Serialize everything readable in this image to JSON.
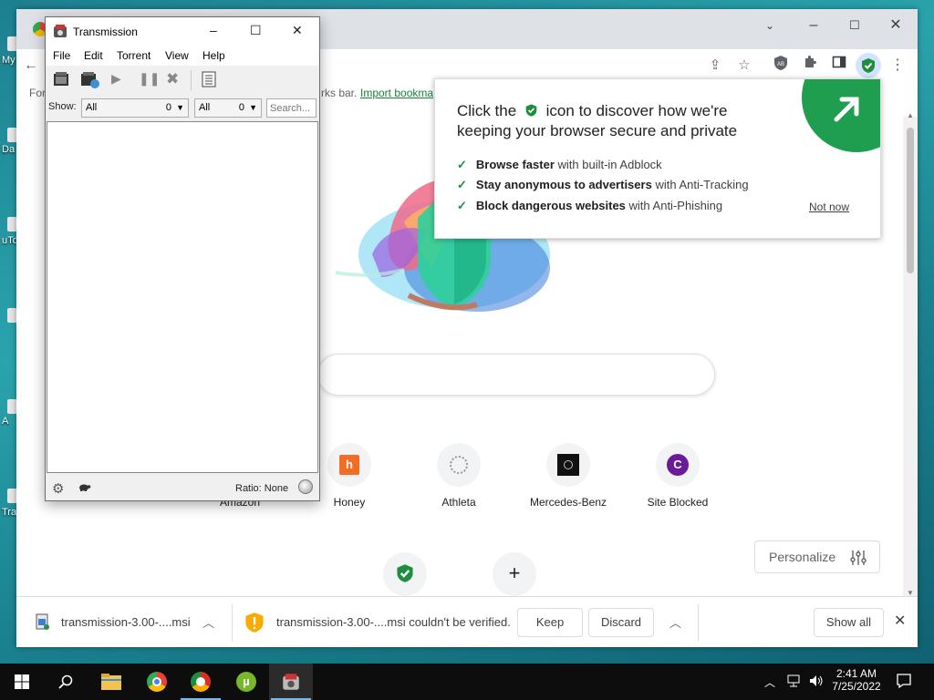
{
  "desktop": {
    "labels": [
      "My",
      "Da",
      "uTo",
      "A",
      "Tra"
    ]
  },
  "transmission": {
    "title": "Transmission",
    "menu": [
      "File",
      "Edit",
      "Torrent",
      "View",
      "Help"
    ],
    "filter": {
      "show_label": "Show:",
      "status_value": "All",
      "status_count": "0",
      "tracker_value": "All",
      "tracker_count": "0",
      "search_placeholder": "Search..."
    },
    "status": {
      "ratio": "Ratio: None"
    }
  },
  "browser": {
    "bookmarks": {
      "prefix": "For",
      "mid": "rks bar.",
      "import_link": "Import bookma"
    },
    "popup": {
      "heading_pre": "Click the",
      "heading_post": "icon to discover how we're keeping your browser secure and private",
      "items": [
        {
          "bold": "Browse faster",
          "rest": "with built-in Adblock"
        },
        {
          "bold": "Stay anonymous to advertisers",
          "rest": "with Anti-Tracking"
        },
        {
          "bold": "Block dangerous websites",
          "rest": "with Anti-Phishing"
        }
      ],
      "not_now": "Not now"
    },
    "shortcuts": [
      {
        "label": "Amazon"
      },
      {
        "label": "Honey"
      },
      {
        "label": "Athleta"
      },
      {
        "label": "Mercedes-Benz"
      },
      {
        "label": "Site Blocked",
        "letter": "C"
      }
    ],
    "personalize": "Personalize",
    "downloads": {
      "item1": "transmission-3.00-....msi",
      "item2": "transmission-3.00-....msi couldn't be verified.",
      "keep": "Keep",
      "discard": "Discard",
      "show_all": "Show all"
    }
  },
  "taskbar": {
    "time": "2:41 AM",
    "date": "7/25/2022"
  },
  "colors": {
    "accent_green": "#1e8e3e",
    "shield_green": "#1e9e4e",
    "link_green": "#188038"
  }
}
